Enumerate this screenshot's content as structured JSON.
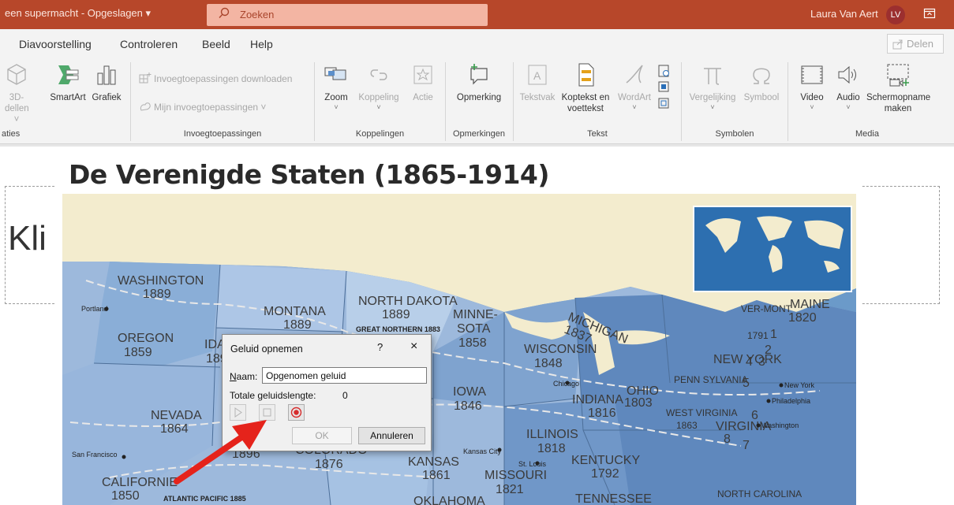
{
  "titlebar": {
    "doc_title": "een supermacht  -  Opgeslagen",
    "search_label": "Zoeken",
    "user_name": "Laura Van Aert",
    "user_initials": "LV",
    "accent": "#b7472a"
  },
  "menu": {
    "tabs": [
      "Diavoorstelling",
      "Controleren",
      "Beeld",
      "Help"
    ],
    "share_label": "Delen"
  },
  "ribbon": {
    "illustraties": {
      "model3d_label_1": "3D-",
      "model3d_label_2": "dellen",
      "smartart_label": "SmartArt",
      "grafiek_label": "Grafiek",
      "group_label": "aties"
    },
    "invoegtoepassingen": {
      "download_label": "Invoegtoepassingen downloaden",
      "mine_label": "Mijn invoegtoepassingen",
      "group_label": "Invoegtoepassingen"
    },
    "koppelingen": {
      "zoom_label": "Zoom",
      "koppeling_label": "Koppeling",
      "actie_label": "Actie",
      "group_label": "Koppelingen"
    },
    "opmerkingen": {
      "opmerking_label": "Opmerking",
      "group_label": "Opmerkingen"
    },
    "tekst": {
      "tekstvak_label": "Tekstvak",
      "koptekst_label_1": "Koptekst en",
      "koptekst_label_2": "voettekst",
      "wordart_label": "WordArt",
      "group_label": "Tekst"
    },
    "symbolen": {
      "vergelijking_label": "Vergelijking",
      "symbool_label": "Symbool",
      "group_label": "Symbolen"
    },
    "media": {
      "video_label": "Video",
      "audio_label": "Audio",
      "screen_label_1": "Schermopname",
      "screen_label_2": "maken",
      "group_label": "Media"
    }
  },
  "slide": {
    "placeholder_text": "Kli",
    "map": {
      "title": "De Verenigde Staten (1865-1914)",
      "states": [
        {
          "name": "WASHINGTON",
          "year": "1889"
        },
        {
          "name": "MONTANA",
          "year": "1889"
        },
        {
          "name": "NORTH DAKOTA",
          "year": "1889"
        },
        {
          "name": "MINNE-",
          "year": "SOTA"
        },
        {
          "name": "OREGON",
          "year": "1859"
        },
        {
          "name": "IDAH",
          "year": "189"
        },
        {
          "name": "NEVADA",
          "year": "1864"
        },
        {
          "name": "CALIFORNIE",
          "year": "1850"
        },
        {
          "name": "COLORADO",
          "year": "1876"
        },
        {
          "name": "KANSAS",
          "year": "1861"
        },
        {
          "name": "IOWA",
          "year": "1846"
        },
        {
          "name": "WISCONSIN",
          "year": "1848"
        },
        {
          "name": "MICHIGAN",
          "year": "1837"
        },
        {
          "name": "ILLINOIS",
          "year": "1818"
        },
        {
          "name": "INDIANA",
          "year": "1816"
        },
        {
          "name": "OHIO",
          "year": "1803"
        },
        {
          "name": "MISSOURI",
          "year": "1821"
        },
        {
          "name": "KENTUCKY",
          "year": "1792"
        },
        {
          "name": "WEST VIRGINIA",
          "year": "1863"
        },
        {
          "name": "VIRGINIA",
          "year": ""
        },
        {
          "name": "TENNESSEE",
          "year": ""
        },
        {
          "name": "NORTH CAROLINA",
          "year": ""
        },
        {
          "name": "NEW YORK",
          "year": ""
        },
        {
          "name": "PENN SYLVANIA",
          "year": ""
        },
        {
          "name": "MAINE",
          "year": "1820"
        },
        {
          "name": "VER-MONT",
          "year": "1791"
        },
        {
          "name": "OKLAHOMA",
          "year": ""
        }
      ],
      "minnesota_year": "1858",
      "cities": [
        "Portland",
        "San Francisco",
        "Chicago",
        "Kansas City",
        "St. Louis",
        "New York",
        "Philadelphia",
        "Washington"
      ],
      "railroads": [
        "GREAT NORTHERN 1883",
        "ATLANTIC PACIFIC 1885"
      ],
      "partial_label": "1896",
      "numbers": [
        "1",
        "2",
        "3",
        "4",
        "5",
        "6",
        "7",
        "8"
      ]
    }
  },
  "dialog": {
    "title": "Geluid opnemen",
    "help": "?",
    "close": "×",
    "name_label": "Naam:",
    "name_value": "Opgenomen geluid",
    "length_label": "Totale geluidslengte:",
    "length_value": "0",
    "ok_label": "OK",
    "cancel_label": "Annuleren"
  },
  "colors": {
    "record_red": "#d62c2c",
    "arrow_red": "#e5231b",
    "map_sea": "#5f8fbf",
    "map_land": "#a9c2e0",
    "canada": "#f5efd2"
  }
}
